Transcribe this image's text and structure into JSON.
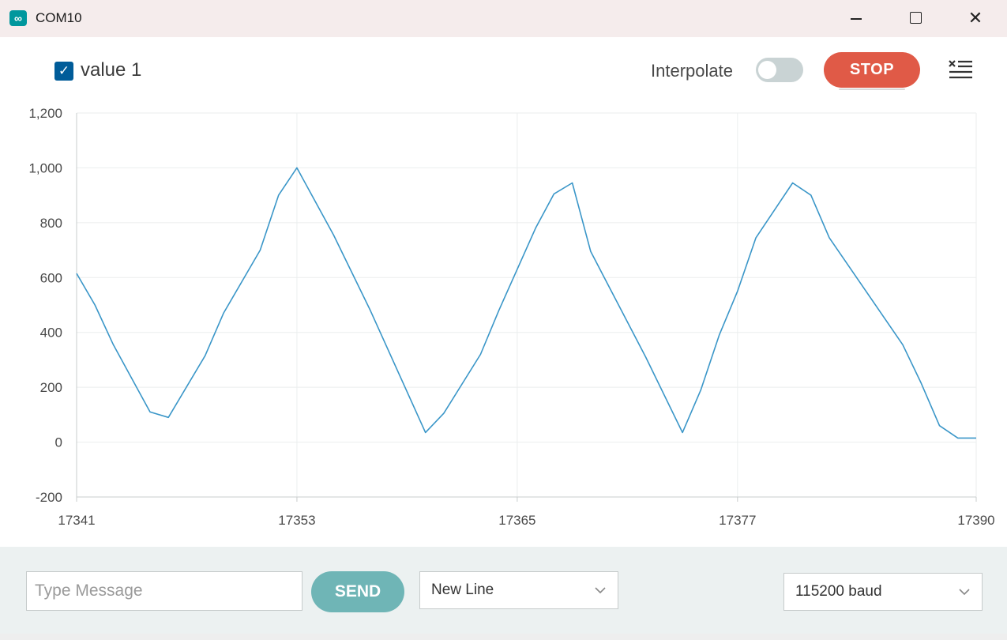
{
  "window": {
    "title": "COM10",
    "app_icon": "arduino-infinity-icon",
    "app_icon_glyph": "∞"
  },
  "toolbar": {
    "legend_label": "value 1",
    "legend_checked": true,
    "interpolate_label": "Interpolate",
    "interpolate_on": false,
    "stop_label": "STOP",
    "clear_icon": "clear-list-icon"
  },
  "footer": {
    "message_placeholder": "Type Message",
    "send_label": "SEND",
    "line_ending": "New Line",
    "baud": "115200 baud"
  },
  "colors": {
    "series": "#3a96c8",
    "stop": "#e05a47",
    "send": "#6fb5b6",
    "checkbox": "#005c99"
  },
  "chart_data": {
    "type": "line",
    "title": "",
    "xlabel": "",
    "ylabel": "",
    "xlim": [
      17341,
      17390
    ],
    "ylim": [
      -200,
      1200
    ],
    "x_ticks": [
      17341,
      17353,
      17365,
      17377,
      17390
    ],
    "y_ticks": [
      -200,
      0,
      200,
      400,
      600,
      800,
      1000,
      1200
    ],
    "y_tick_labels": [
      "-200",
      "0",
      "200",
      "400",
      "600",
      "800",
      "1,000",
      "1,200"
    ],
    "grid": true,
    "series": [
      {
        "name": "value 1",
        "x": [
          17341,
          17342,
          17343,
          17345,
          17346,
          17348,
          17349,
          17351,
          17352,
          17353,
          17355,
          17357,
          17360,
          17361,
          17363,
          17364,
          17366,
          17367,
          17368,
          17369,
          17372,
          17374,
          17375,
          17376,
          17377,
          17378,
          17380,
          17381,
          17382,
          17386,
          17387,
          17388,
          17389,
          17390
        ],
        "y": [
          615,
          500,
          355,
          110,
          90,
          315,
          470,
          700,
          900,
          1000,
          755,
          480,
          35,
          105,
          320,
          480,
          780,
          905,
          945,
          695,
          310,
          35,
          190,
          390,
          550,
          745,
          945,
          900,
          745,
          355,
          215,
          60,
          15,
          15
        ]
      }
    ]
  }
}
